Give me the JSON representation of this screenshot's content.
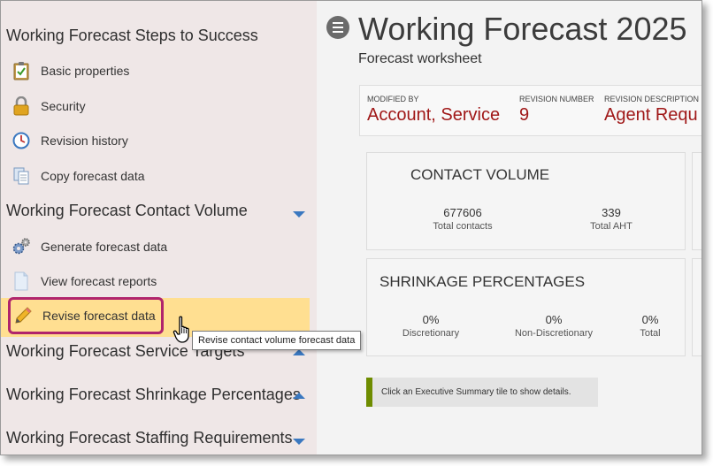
{
  "sidebar": {
    "sections": [
      {
        "title": "Working Forecast Steps to Success",
        "items": [
          {
            "label": "Basic properties",
            "icon": "clipboard-check-icon"
          },
          {
            "label": "Security",
            "icon": "lock-icon"
          },
          {
            "label": "Revision history",
            "icon": "clock-icon"
          },
          {
            "label": "Copy forecast data",
            "icon": "copy-document-icon"
          }
        ]
      },
      {
        "title": "Working Forecast Contact Volume",
        "items": [
          {
            "label": "Generate forecast data",
            "icon": "gears-icon"
          },
          {
            "label": "View forecast reports",
            "icon": "document-icon"
          },
          {
            "label": "Revise forecast data",
            "icon": "pencil-icon"
          }
        ]
      },
      {
        "title": "Working Forecast Service Targets"
      },
      {
        "title": "Working Forecast Shrinkage Percentages"
      },
      {
        "title": "Working Forecast Staffing Requirements"
      }
    ]
  },
  "tooltip": {
    "text": "Revise contact volume forecast data"
  },
  "main": {
    "title": "Working Forecast 2025",
    "subtitle": "Forecast worksheet",
    "info": {
      "modified_by_label": "MODIFIED BY",
      "modified_by_value": "Account, Service",
      "revision_number_label": "REVISION NUMBER",
      "revision_number_value": "9",
      "revision_description_label": "REVISION DESCRIPTION",
      "revision_description_value": "Agent Requ"
    },
    "contact_volume": {
      "title": "CONTACT VOLUME",
      "stats": [
        {
          "value": "677606",
          "label": "Total contacts"
        },
        {
          "value": "339",
          "label": "Total AHT"
        }
      ]
    },
    "shrinkage": {
      "title": "SHRINKAGE PERCENTAGES",
      "stats": [
        {
          "value": "0%",
          "label": "Discretionary"
        },
        {
          "value": "0%",
          "label": "Non-Discretionary"
        },
        {
          "value": "0%",
          "label": "Total"
        }
      ]
    },
    "status_message": "Click an Executive Summary tile to show details."
  },
  "colors": {
    "accent_blue": "#3a78c0",
    "highlight": "#ffdf91",
    "highlight_border": "#b0246c",
    "value_red": "#a01818",
    "status_accent": "#6e8c00"
  }
}
